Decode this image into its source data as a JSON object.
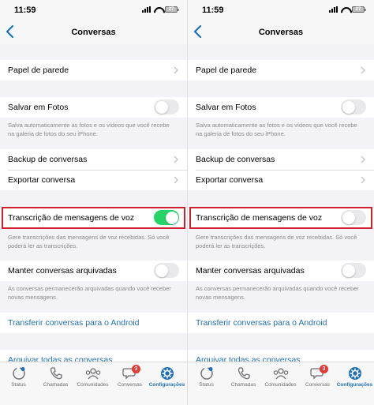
{
  "screens": [
    {
      "status": {
        "time": "11:59",
        "battery": "27"
      },
      "nav": {
        "title": "Conversas"
      },
      "rows": {
        "wallpaper": "Papel de parede",
        "save_photos": "Salvar em Fotos",
        "save_photos_note": "Salva automaticamente as fotos e os vídeos que você recebe na galeria de fotos do seu iPhone.",
        "backup": "Backup de conversas",
        "export": "Exportar conversa",
        "transcription": "Transcrição de mensagens de voz",
        "transcription_note": "Gere transcrições das mensagens de voz recebidas. Só você poderá ler as transcrições.",
        "keep_archived": "Manter conversas arquivadas",
        "keep_archived_note": "As conversas permanecerão arquivadas quando você receber novas mensagens.",
        "transfer_android": "Transferir conversas para o Android",
        "archive_all": "Arquivar todas as conversas"
      },
      "toggles": {
        "save_photos": false,
        "transcription": true,
        "keep_archived": false
      },
      "tabs": {
        "status": "Status",
        "calls": "Chamadas",
        "communities": "Comunidades",
        "chats": "Conversas",
        "chats_badge": "3",
        "settings": "Configurações"
      }
    },
    {
      "status": {
        "time": "11:59",
        "battery": "27"
      },
      "nav": {
        "title": "Conversas"
      },
      "rows": {
        "wallpaper": "Papel de parede",
        "save_photos": "Salvar em Fotos",
        "save_photos_note": "Salva automaticamente as fotos e os vídeos que você recebe na galeria de fotos do seu iPhone.",
        "backup": "Backup de conversas",
        "export": "Exportar conversa",
        "transcription": "Transcrição de mensagens de voz",
        "transcription_note": "Gere transcrições das mensagens de voz recebidas. Só você poderá ler as transcrições.",
        "keep_archived": "Manter conversas arquivadas",
        "keep_archived_note": "As conversas permanecerão arquivadas quando você receber novas mensagens.",
        "transfer_android": "Transferir conversas para o Android",
        "archive_all": "Arquivar todas as conversas"
      },
      "toggles": {
        "save_photos": false,
        "transcription": false,
        "keep_archived": false
      },
      "tabs": {
        "status": "Status",
        "calls": "Chamadas",
        "communities": "Comunidades",
        "chats": "Conversas",
        "chats_badge": "3",
        "settings": "Configurações"
      }
    }
  ],
  "colors": {
    "accent_green": "#25d366",
    "link_blue": "#1f6fb5",
    "highlight_red": "#d0202e",
    "background": "#f2f2f7"
  }
}
